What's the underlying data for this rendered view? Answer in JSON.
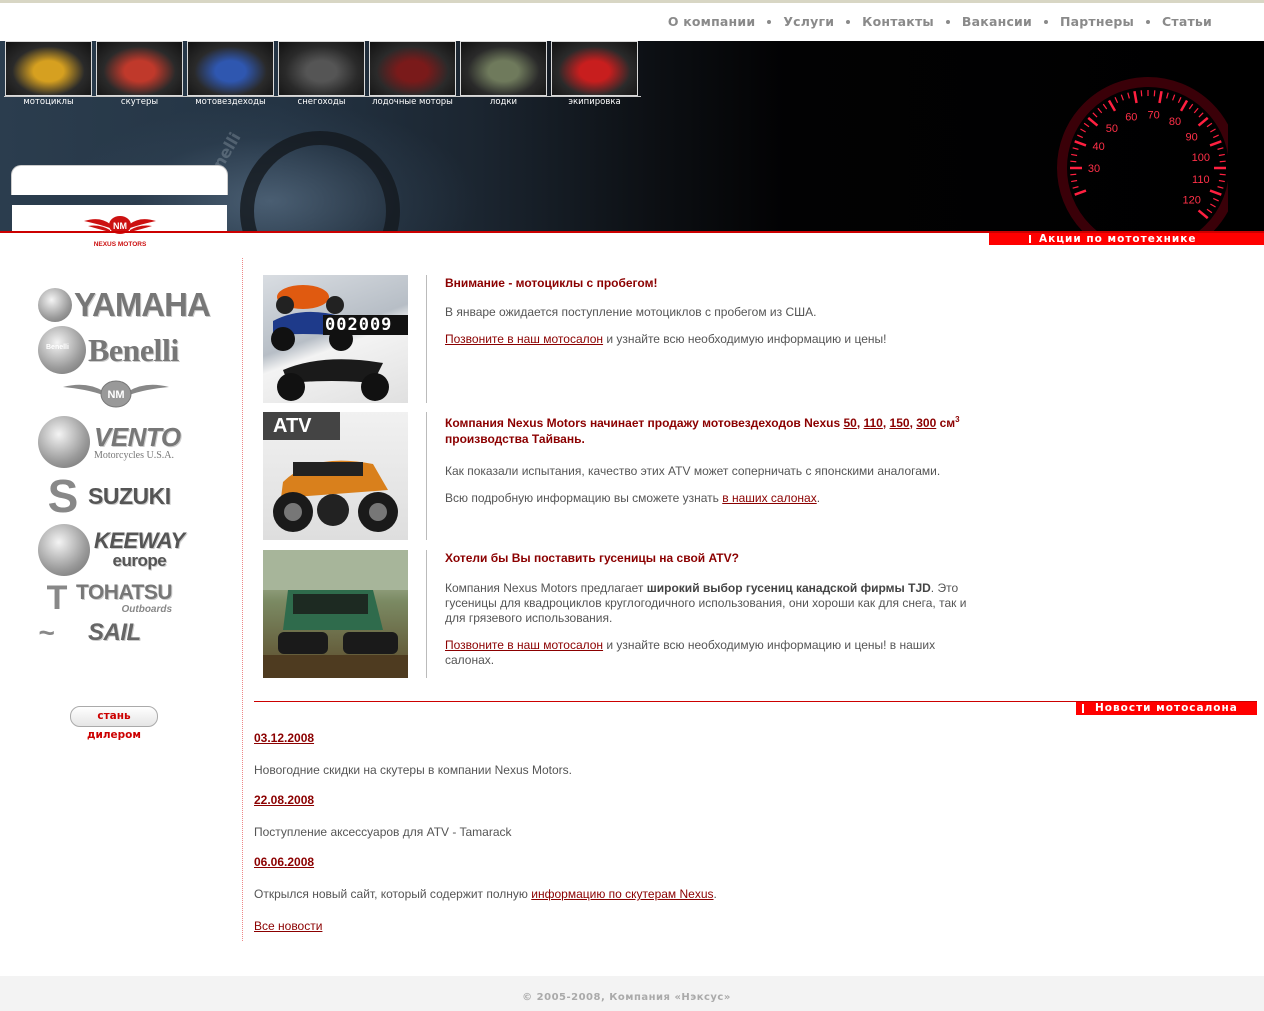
{
  "nav": {
    "items": [
      "О компании",
      "Услуги",
      "Контакты",
      "Вакансии",
      "Партнеры",
      "Статьи"
    ]
  },
  "header": {
    "categories": [
      {
        "label": "мотоциклы",
        "icon": "motorcycle-photo",
        "color": "#d6a020"
      },
      {
        "label": "скутеры",
        "icon": "scooter-photo",
        "color": "#c0392b"
      },
      {
        "label": "мотовездеходы",
        "icon": "atv-photo",
        "color": "#2f57b0"
      },
      {
        "label": "снегоходы",
        "icon": "snowmobile-photo",
        "color": "#555555"
      },
      {
        "label": "лодочные моторы",
        "icon": "outboard-motor-photo",
        "color": "#7a1a1a"
      },
      {
        "label": "лодки",
        "icon": "boat-photo",
        "color": "#6f7a5c"
      },
      {
        "label": "экипировка",
        "icon": "helmet-photo",
        "color": "#c81e1e"
      }
    ],
    "speedometer_ticks": [
      "30",
      "40",
      "50",
      "60",
      "70",
      "80",
      "90",
      "100",
      "110",
      "120"
    ],
    "logo_text": "NEXUS MOTORS",
    "logo_badge": "NM",
    "promo_label": "Акции по мототехнике"
  },
  "sidebar": {
    "brands": [
      "YAMAHA",
      "Benelli",
      "NM",
      "VENTO",
      "SUZUKI",
      "KEEWAY",
      "TOHATSU",
      "SAIL"
    ],
    "vento_sub": "Motorcycles U.S.A.",
    "keeway_sub": "europe",
    "tohatsu_sub": "Outboards",
    "benelli_badge": "Benelli",
    "dealer_button": "стань дилером"
  },
  "articles": [
    {
      "title": "Внимание - мотоциклы с пробегом!",
      "p1": "В январе ожидается поступление мотоциклов с пробегом из США.",
      "p2_link": "Позвоните в наш мотосалон",
      "p2_rest": " и узнайте всю необходимую информацию и цены!",
      "odometer": "002009"
    },
    {
      "title_pre": "Компания Nexus Motors начинает продажу мотовездеходов Nexus ",
      "links": [
        "50",
        "110",
        "150",
        "300"
      ],
      "title_unit": " см",
      "title_sup": "3",
      "title_post": " производства Тайвань.",
      "p1": "Как показали испытания, качество этих ATV может соперничать с японскими аналогами.",
      "p2_pre": "Всю подробную информацию вы сможете узнать ",
      "p2_link": "в наших салонах",
      "p2_post": ".",
      "badge": "ATV"
    },
    {
      "title": "Хотели бы Вы поставить гусеницы на свой ATV?",
      "p1_pre": "Компания Nexus Motors предлагает ",
      "p1_bold": "широкий выбор гусениц канадской фирмы TJD",
      "p1_post": ". Это гусеницы для квадроциклов круглогодичного использования, они хороши как для снега, так и для грязевого использования.",
      "p2_link": "Позвоните в наш мотосалон",
      "p2_rest": " и узнайте всю необходимую информацию и цены! в наших салонах."
    }
  ],
  "news": {
    "section_label": "Новости мотосалона",
    "items": [
      {
        "date": "03.12.2008",
        "text": "Новогодние скидки на скутеры в компании Nexus Motors."
      },
      {
        "date": "22.08.2008",
        "text": "Поступление аксессуаров для ATV - Tamarack"
      },
      {
        "date": "06.06.2008",
        "text_pre": "Открылся новый сайт, который содержит полную ",
        "link": "информацию по скутерам Nexus",
        "text_post": "."
      }
    ],
    "all_link": "Все новости"
  },
  "footer": {
    "copyright": "© 2005-2008, Компания «Нэксус»"
  },
  "colors": {
    "accent_red": "#ff0000",
    "link_dark_red": "#8b0000",
    "nav_gray": "#8a8a8a"
  }
}
